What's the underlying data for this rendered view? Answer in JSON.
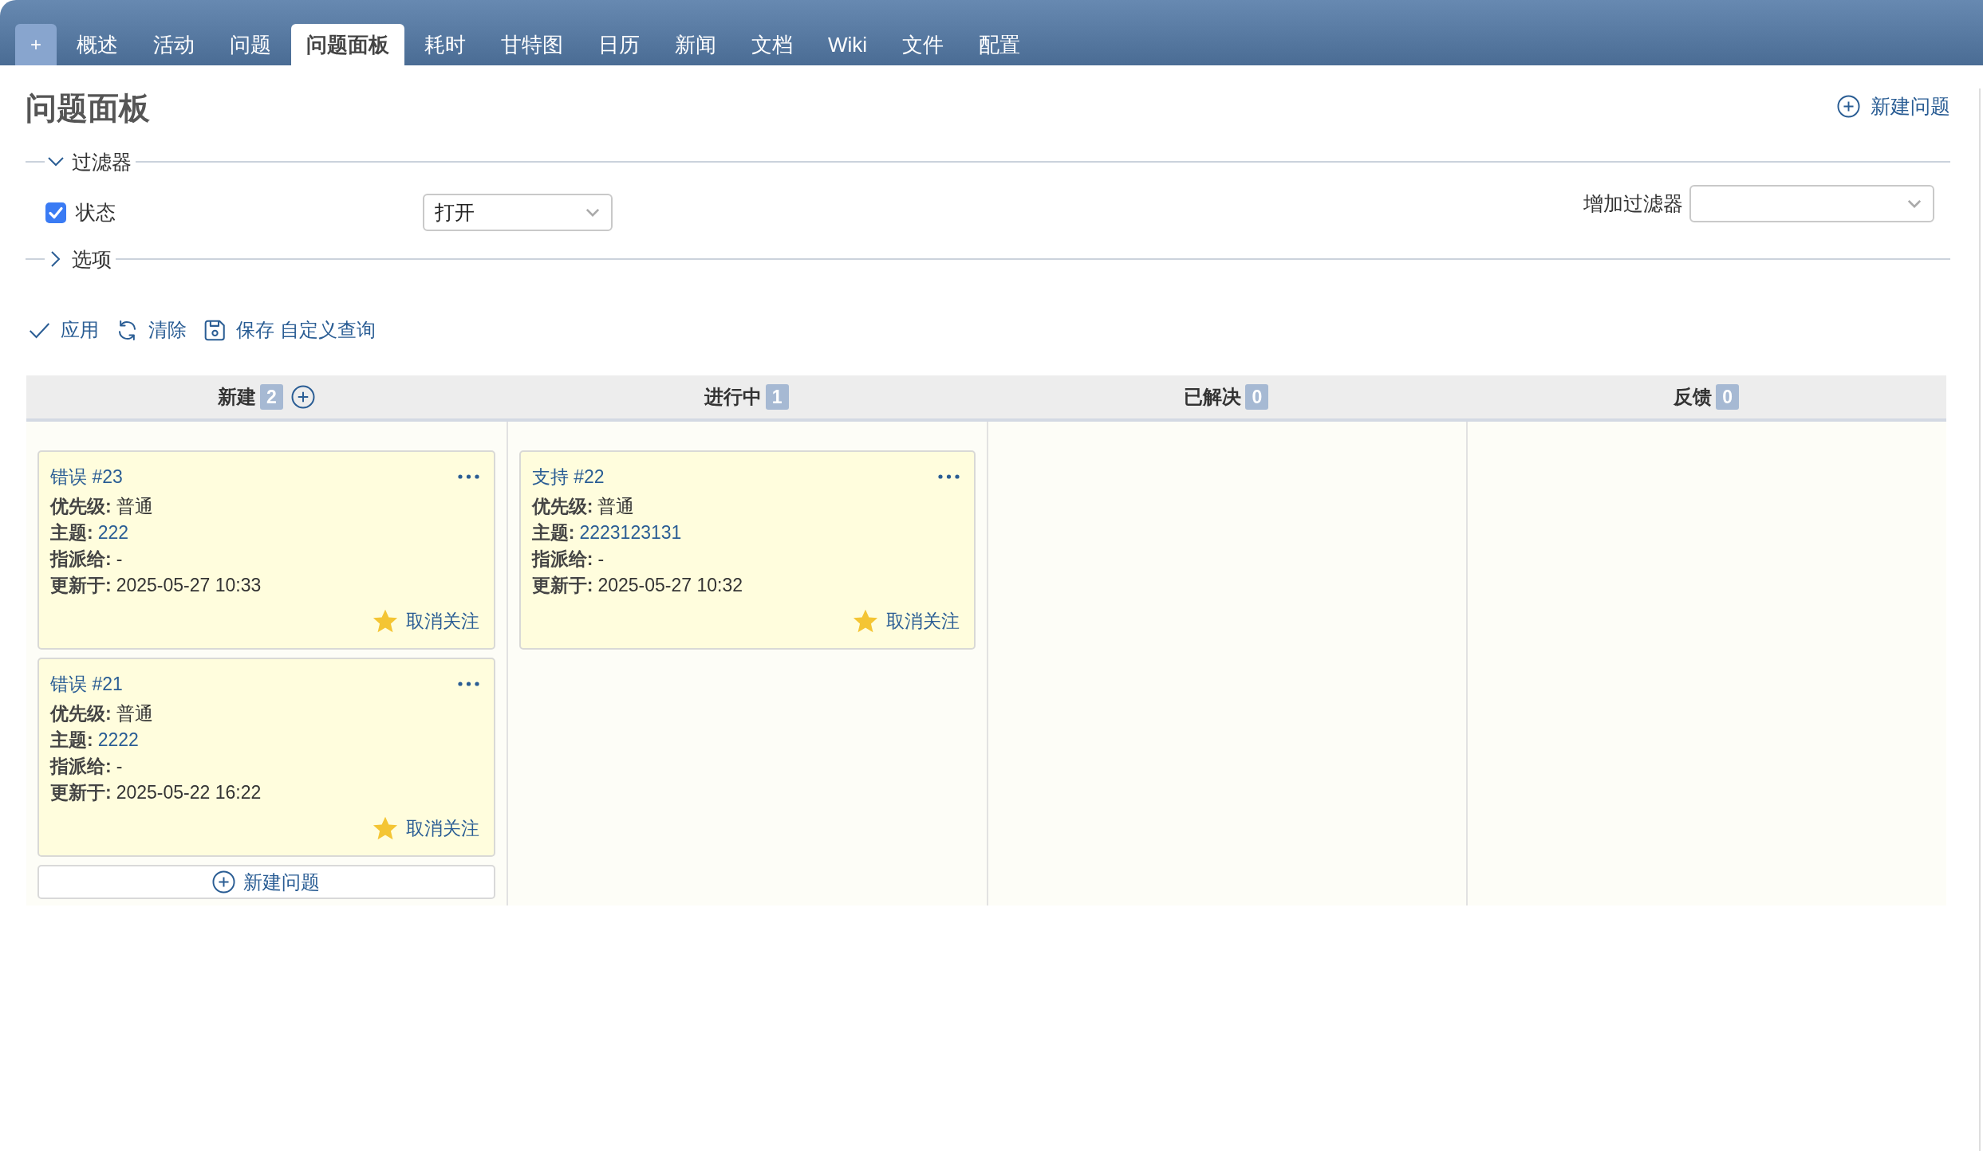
{
  "tabs": [
    {
      "label": "+",
      "kind": "add",
      "selected": false
    },
    {
      "label": "概述",
      "kind": "page",
      "selected": false
    },
    {
      "label": "活动",
      "kind": "page",
      "selected": false
    },
    {
      "label": "问题",
      "kind": "page",
      "selected": false
    },
    {
      "label": "问题面板",
      "kind": "page",
      "selected": true
    },
    {
      "label": "耗时",
      "kind": "page",
      "selected": false
    },
    {
      "label": "甘特图",
      "kind": "page",
      "selected": false
    },
    {
      "label": "日历",
      "kind": "page",
      "selected": false
    },
    {
      "label": "新闻",
      "kind": "page",
      "selected": false
    },
    {
      "label": "文档",
      "kind": "page",
      "selected": false
    },
    {
      "label": "Wiki",
      "kind": "page",
      "selected": false
    },
    {
      "label": "文件",
      "kind": "page",
      "selected": false
    },
    {
      "label": "配置",
      "kind": "page",
      "selected": false
    }
  ],
  "header": {
    "title": "问题面板",
    "new_issue_link": "新建问题"
  },
  "filters": {
    "legend": "过滤器",
    "expanded": true,
    "rows": [
      {
        "label": "状态",
        "checked": true,
        "value": "打开"
      }
    ],
    "add_filter": {
      "label": "增加过滤器"
    }
  },
  "options": {
    "legend": "选项",
    "expanded": false
  },
  "actions": [
    {
      "kind": "apply",
      "label": "应用"
    },
    {
      "kind": "clear",
      "label": "清除"
    },
    {
      "kind": "save",
      "label": "保存 自定义查询"
    }
  ],
  "board": {
    "columns": [
      {
        "name": "新建",
        "count": "2",
        "can_add": true,
        "add_button": "新建问题",
        "cards": [
          {
            "title": "错误 #23",
            "fields": [
              {
                "name": "优先级:",
                "value": "普通",
                "kind": "plain"
              },
              {
                "name": "主题:",
                "value": "222",
                "kind": "link"
              },
              {
                "name": "指派给:",
                "value": "-",
                "kind": "plain"
              },
              {
                "name": "更新于:",
                "value": "2025-05-27 10:33",
                "kind": "plain"
              }
            ],
            "watch_label": "取消关注",
            "watched": true
          },
          {
            "title": "错误 #21",
            "fields": [
              {
                "name": "优先级:",
                "value": "普通",
                "kind": "plain"
              },
              {
                "name": "主题:",
                "value": "2222",
                "kind": "link"
              },
              {
                "name": "指派给:",
                "value": "-",
                "kind": "plain"
              },
              {
                "name": "更新于:",
                "value": "2025-05-22 16:22",
                "kind": "plain"
              }
            ],
            "watch_label": "取消关注",
            "watched": true
          }
        ]
      },
      {
        "name": "进行中",
        "count": "1",
        "can_add": false,
        "cards": [
          {
            "title": "支持 #22",
            "fields": [
              {
                "name": "优先级:",
                "value": "普通",
                "kind": "plain"
              },
              {
                "name": "主题:",
                "value": "2223123131",
                "kind": "link"
              },
              {
                "name": "指派给:",
                "value": "-",
                "kind": "plain"
              },
              {
                "name": "更新于:",
                "value": "2025-05-27 10:32",
                "kind": "plain"
              }
            ],
            "watch_label": "取消关注",
            "watched": true
          }
        ]
      },
      {
        "name": "已解决",
        "count": "0",
        "can_add": false
      },
      {
        "name": "反馈",
        "count": "0",
        "can_add": false
      }
    ]
  }
}
